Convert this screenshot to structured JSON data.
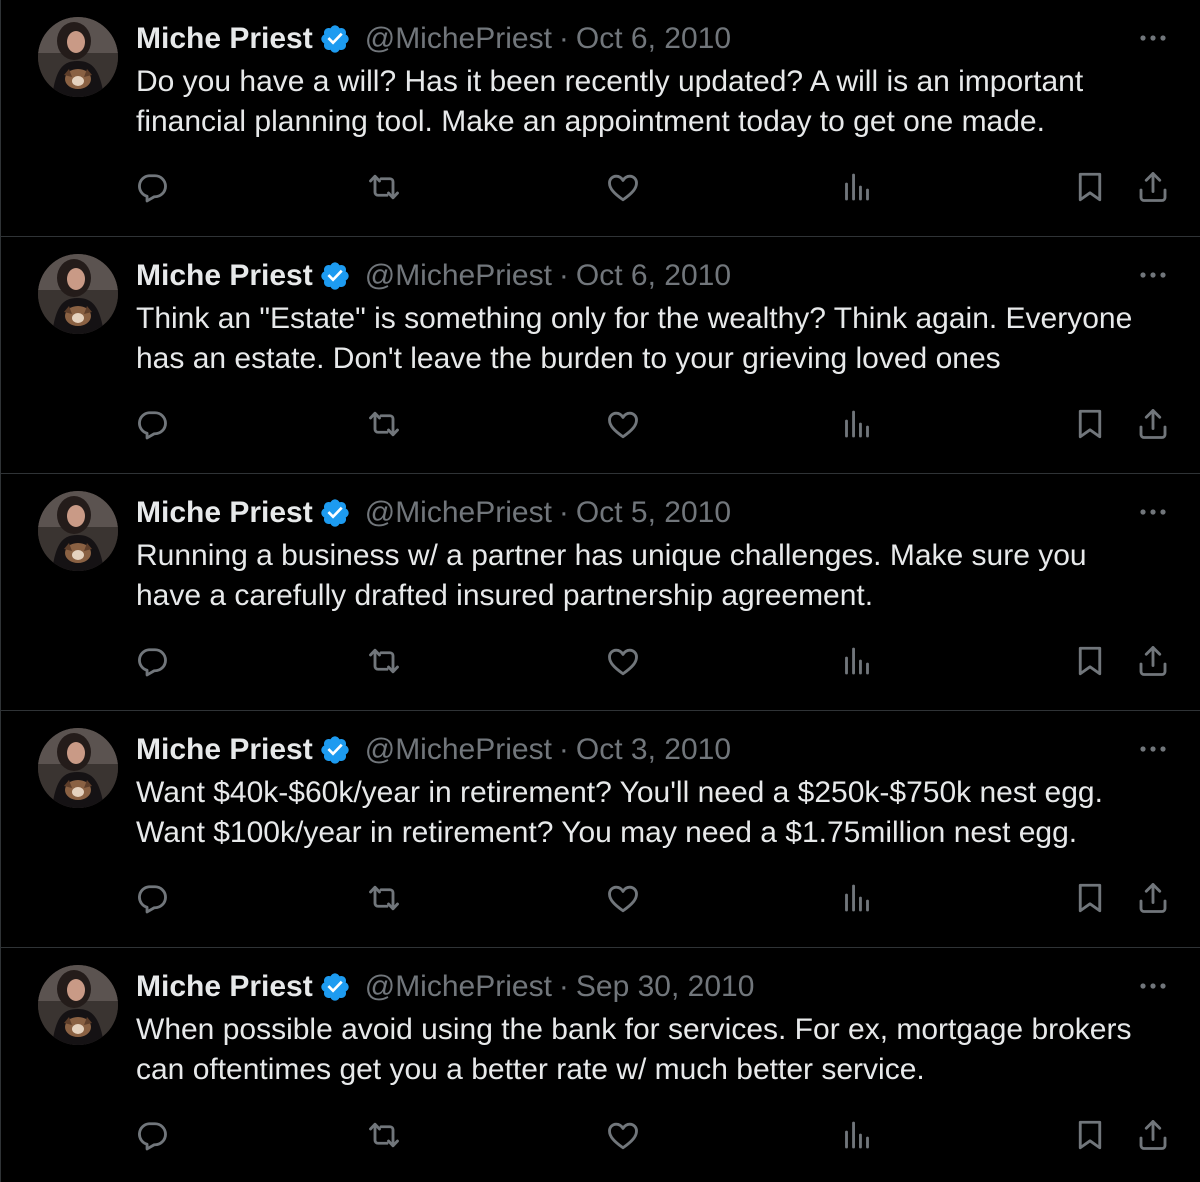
{
  "colors": {
    "background": "#000000",
    "text_primary": "#e7e9ea",
    "text_secondary": "#71767b",
    "divider": "#2f3336",
    "verified_badge": "#1d9bf0"
  },
  "icons": {
    "verified": "verified-badge-icon",
    "more": "more-dots-icon",
    "reply": "reply-bubble-icon",
    "retweet": "retweet-arrows-icon",
    "like": "heart-icon",
    "views": "views-bar-chart-icon",
    "bookmark": "bookmark-icon",
    "share": "share-upload-icon"
  },
  "tweets": [
    {
      "name": "Miche Priest",
      "handle": "@MichePriest",
      "separator": "·",
      "date": "Oct 6, 2010",
      "text": "Do you have a will? Has it been recently updated? A will is an important\nfinancial planning tool. Make an appointment today to get one made."
    },
    {
      "name": "Miche Priest",
      "handle": "@MichePriest",
      "separator": "·",
      "date": "Oct 6, 2010",
      "text": "Think an \"Estate\" is something only for the wealthy? Think again. Everyone\nhas an estate. Don't leave the burden to your grieving loved ones"
    },
    {
      "name": "Miche Priest",
      "handle": "@MichePriest",
      "separator": "·",
      "date": "Oct 5, 2010",
      "text": "Running a business w/ a partner has unique challenges. Make sure you\nhave a carefully drafted insured partnership agreement."
    },
    {
      "name": "Miche Priest",
      "handle": "@MichePriest",
      "separator": "·",
      "date": "Oct 3, 2010",
      "text": "Want $40k-$60k/year in retirement? You'll need a $250k-$750k nest egg.\nWant $100k/year in retirement? You may need a $1.75million nest egg."
    },
    {
      "name": "Miche Priest",
      "handle": "@MichePriest",
      "separator": "·",
      "date": "Sep 30, 2010",
      "text": "When possible avoid using the bank for services. For ex, mortgage brokers\ncan oftentimes get you a better rate w/ much better service."
    }
  ]
}
